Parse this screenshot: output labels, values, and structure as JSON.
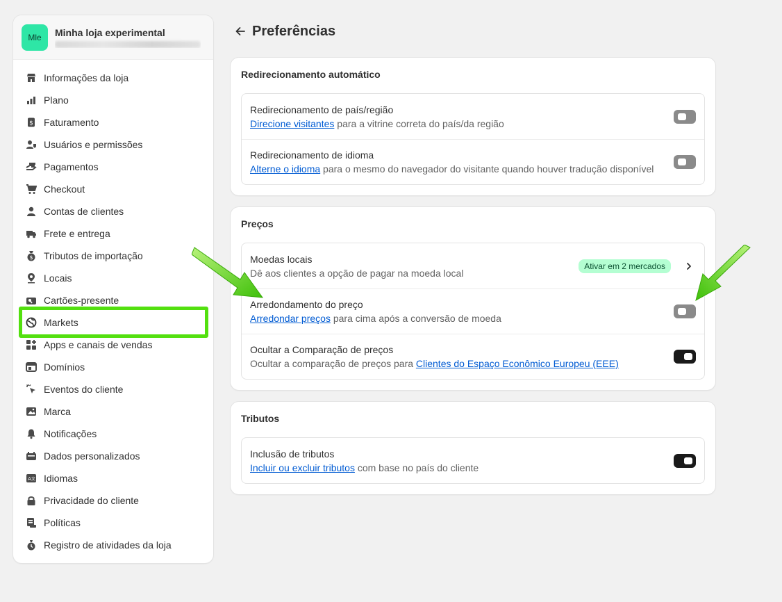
{
  "store": {
    "initials": "Mle",
    "name": "Minha loja experimental"
  },
  "nav": [
    {
      "label": "Informações da loja",
      "icon": "store-icon"
    },
    {
      "label": "Plano",
      "icon": "plan-icon"
    },
    {
      "label": "Faturamento",
      "icon": "billing-icon"
    },
    {
      "label": "Usuários e permissões",
      "icon": "users-icon"
    },
    {
      "label": "Pagamentos",
      "icon": "payments-icon"
    },
    {
      "label": "Checkout",
      "icon": "cart-icon"
    },
    {
      "label": "Contas de clientes",
      "icon": "person-icon"
    },
    {
      "label": "Frete e entrega",
      "icon": "truck-icon"
    },
    {
      "label": "Tributos de importação",
      "icon": "money-bag-icon"
    },
    {
      "label": "Locais",
      "icon": "location-pin-icon"
    },
    {
      "label": "Cartões-presente",
      "icon": "gift-card-icon"
    },
    {
      "label": "Markets",
      "icon": "globe-icon"
    },
    {
      "label": "Apps e canais de vendas",
      "icon": "apps-icon"
    },
    {
      "label": "Domínios",
      "icon": "domains-icon"
    },
    {
      "label": "Eventos do cliente",
      "icon": "cursor-click-icon"
    },
    {
      "label": "Marca",
      "icon": "brand-image-icon"
    },
    {
      "label": "Notificações",
      "icon": "bell-icon"
    },
    {
      "label": "Dados personalizados",
      "icon": "custom-data-icon"
    },
    {
      "label": "Idiomas",
      "icon": "language-icon"
    },
    {
      "label": "Privacidade do cliente",
      "icon": "lock-icon"
    },
    {
      "label": "Políticas",
      "icon": "policy-icon"
    },
    {
      "label": "Registro de atividades da loja",
      "icon": "activity-log-icon"
    }
  ],
  "page": {
    "title": "Preferências"
  },
  "redirect": {
    "title": "Redirecionamento automático",
    "rows": [
      {
        "label": "Redirecionamento de país/região",
        "link": "Direcione visitantes",
        "rest": " para a vitrine correta do país/da região",
        "on": false
      },
      {
        "label": "Redirecionamento de idioma",
        "link": "Alterne o idioma",
        "rest": " para o mesmo do navegador do visitante quando houver tradução disponível",
        "on": false
      }
    ]
  },
  "prices": {
    "title": "Preços",
    "local_currency": {
      "label": "Moedas locais",
      "desc": "Dê aos clientes a opção de pagar na moeda local",
      "badge": "Ativar em 2 mercados"
    },
    "rounding": {
      "label": "Arredondamento do preço",
      "link": "Arredondar preços",
      "rest": " para cima após a conversão de moeda",
      "on": false
    },
    "compare": {
      "label": "Ocultar a Comparação de preços",
      "pre": "Ocultar a comparação de preços para ",
      "link": "Clientes do Espaço Econômico Europeu (EEE)",
      "on": true
    }
  },
  "taxes": {
    "title": "Tributos",
    "inclusion": {
      "label": "Inclusão de tributos",
      "link": "Incluir ou excluir tributos",
      "rest": " com base no país do cliente",
      "on": true
    }
  },
  "colors": {
    "accent_green": "#53e00f",
    "link": "#005bd3",
    "badge_bg": "#b4fed2"
  }
}
